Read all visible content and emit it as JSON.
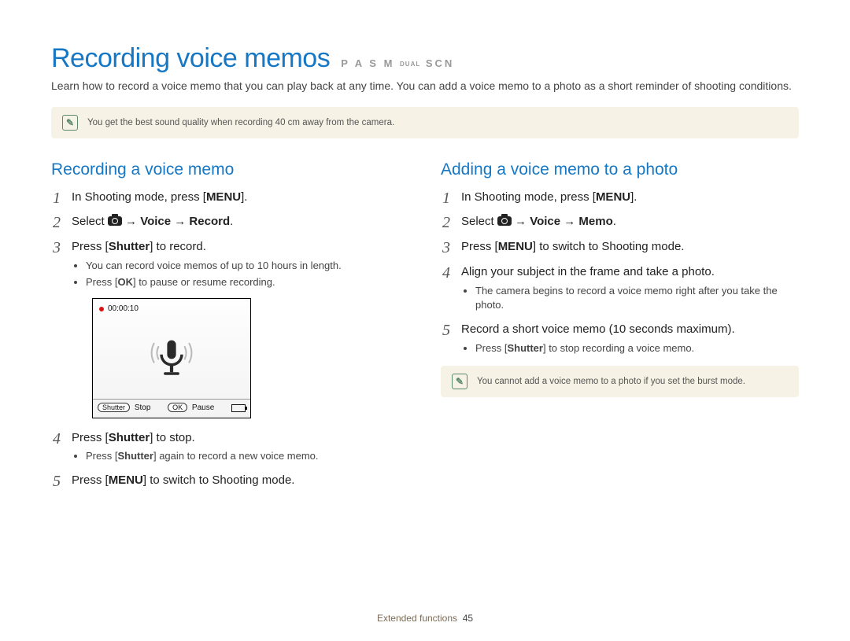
{
  "header": {
    "title": "Recording voice memos",
    "modes": "P A S M ",
    "modes_small": "DUAL",
    "modes_end": " SCN"
  },
  "intro": "Learn how to record a voice memo that you can play back at any time. You can add a voice memo to a photo as a short reminder of shooting conditions.",
  "tip_top": "You get the best sound quality when recording 40 cm away from the camera.",
  "left": {
    "heading": "Recording a voice memo",
    "step1_a": "In Shooting mode, press [",
    "step1_b": "MENU",
    "step1_c": "].",
    "step2_a": "Select ",
    "step2_b": " → Voice → Record",
    "step2_c": ".",
    "step3_a": "Press [",
    "step3_b": "Shutter",
    "step3_c": "] to record.",
    "step3_bul1": "You can record voice memos of up to 10 hours in length.",
    "step3_bul2_a": "Press [",
    "step3_bul2_b": "OK",
    "step3_bul2_c": "] to pause or resume recording.",
    "step4_a": "Press [",
    "step4_b": "Shutter",
    "step4_c": "] to stop.",
    "step4_bul_a": "Press [",
    "step4_bul_b": "Shutter",
    "step4_bul_c": "] again to record a new voice memo.",
    "step5_a": "Press [",
    "step5_b": "MENU",
    "step5_c": "] to switch to Shooting mode.",
    "screenshot": {
      "time": "00:00:10",
      "shutter_cap": "Shutter",
      "stop": "Stop",
      "ok_cap": "OK",
      "pause": "Pause"
    }
  },
  "right": {
    "heading": "Adding a voice memo to a photo",
    "step1_a": "In Shooting mode, press [",
    "step1_b": "MENU",
    "step1_c": "].",
    "step2_a": "Select ",
    "step2_b": " → Voice → Memo",
    "step2_c": ".",
    "step3_a": "Press [",
    "step3_b": "MENU",
    "step3_c": "] to switch to Shooting mode.",
    "step4": "Align your subject in the frame and take a photo.",
    "step4_bul": "The camera begins to record a voice memo right after you take the photo.",
    "step5": "Record a short voice memo (10 seconds maximum).",
    "step5_bul_a": "Press [",
    "step5_bul_b": "Shutter",
    "step5_bul_c": "] to stop recording a voice memo.",
    "tip": "You cannot add a voice memo to a photo if you set the burst mode."
  },
  "footer": {
    "section": "Extended functions",
    "page": "45"
  }
}
